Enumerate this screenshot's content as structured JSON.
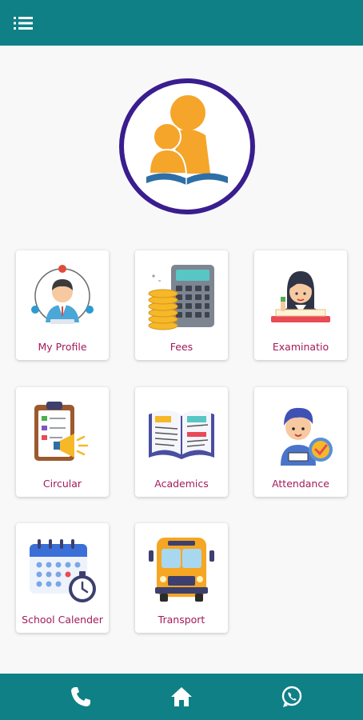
{
  "header": {
    "menu_icon": "list-menu-icon"
  },
  "logo": {
    "icon": "school-logo-icon",
    "colors": {
      "ring": "#3a1d8f",
      "figure": "#f4a52a",
      "book": "#2e6fa7"
    }
  },
  "tiles": [
    {
      "label": "My Profile",
      "icon": "profile-icon"
    },
    {
      "label": "Fees",
      "icon": "fees-calculator-icon"
    },
    {
      "label": "Examinatio",
      "icon": "examination-icon"
    },
    {
      "label": "Circular",
      "icon": "circular-clipboard-icon"
    },
    {
      "label": "Academics",
      "icon": "book-icon"
    },
    {
      "label": "Attendance",
      "icon": "attendance-icon"
    },
    {
      "label": "School Calender",
      "icon": "calendar-icon"
    },
    {
      "label": "Transport",
      "icon": "bus-icon"
    }
  ],
  "footer": {
    "icons": [
      "phone-icon",
      "home-icon",
      "whatsapp-icon"
    ]
  },
  "colors": {
    "bar": "#0e8086",
    "label": "#a3195b",
    "background": "#f8f8f8"
  }
}
